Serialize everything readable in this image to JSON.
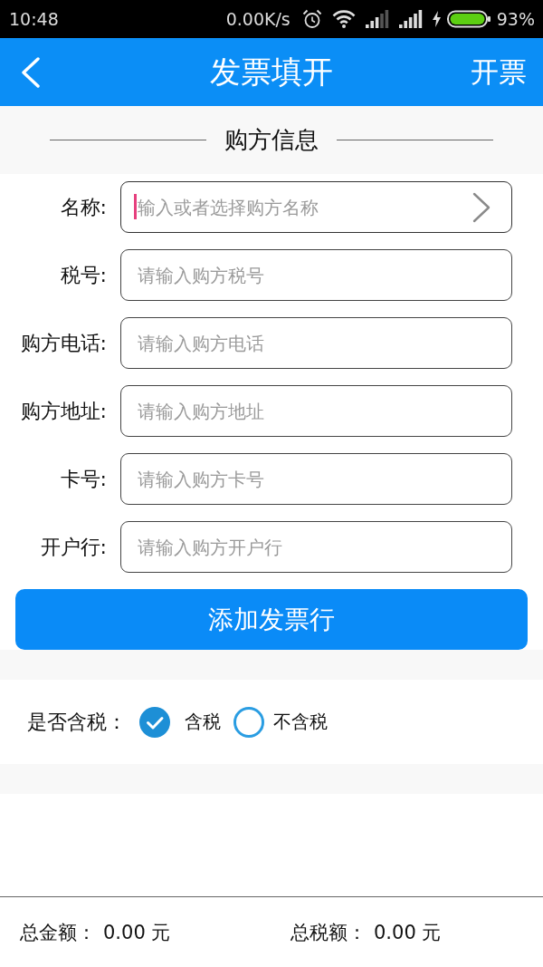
{
  "status_bar": {
    "time": "10:48",
    "net_speed": "0.00K/s",
    "battery_percent": "93%"
  },
  "app_bar": {
    "title": "发票填开",
    "action": "开票"
  },
  "section": {
    "title": "购方信息"
  },
  "fields": [
    {
      "label": "名称:",
      "placeholder": "输入或者选择购方名称",
      "kind": "picker",
      "focused": true
    },
    {
      "label": "税号:",
      "placeholder": "请输入购方税号",
      "kind": "text",
      "focused": false
    },
    {
      "label": "购方电话:",
      "placeholder": "请输入购方电话",
      "kind": "text",
      "focused": false
    },
    {
      "label": "购方地址:",
      "placeholder": "请输入购方地址",
      "kind": "text",
      "focused": false
    },
    {
      "label": "卡号:",
      "placeholder": "请输入购方卡号",
      "kind": "text",
      "focused": false
    },
    {
      "label": "开户行:",
      "placeholder": "请输入购方开户行",
      "kind": "text",
      "focused": false
    }
  ],
  "add_button": {
    "label": "添加发票行"
  },
  "tax_option": {
    "label": "是否含税：",
    "options": [
      {
        "label": "含税",
        "selected": true
      },
      {
        "label": "不含税",
        "selected": false
      }
    ]
  },
  "totals": [
    {
      "label": "总金额：",
      "value": "0.00 元"
    },
    {
      "label": "总税额：",
      "value": "0.00 元"
    }
  ]
}
